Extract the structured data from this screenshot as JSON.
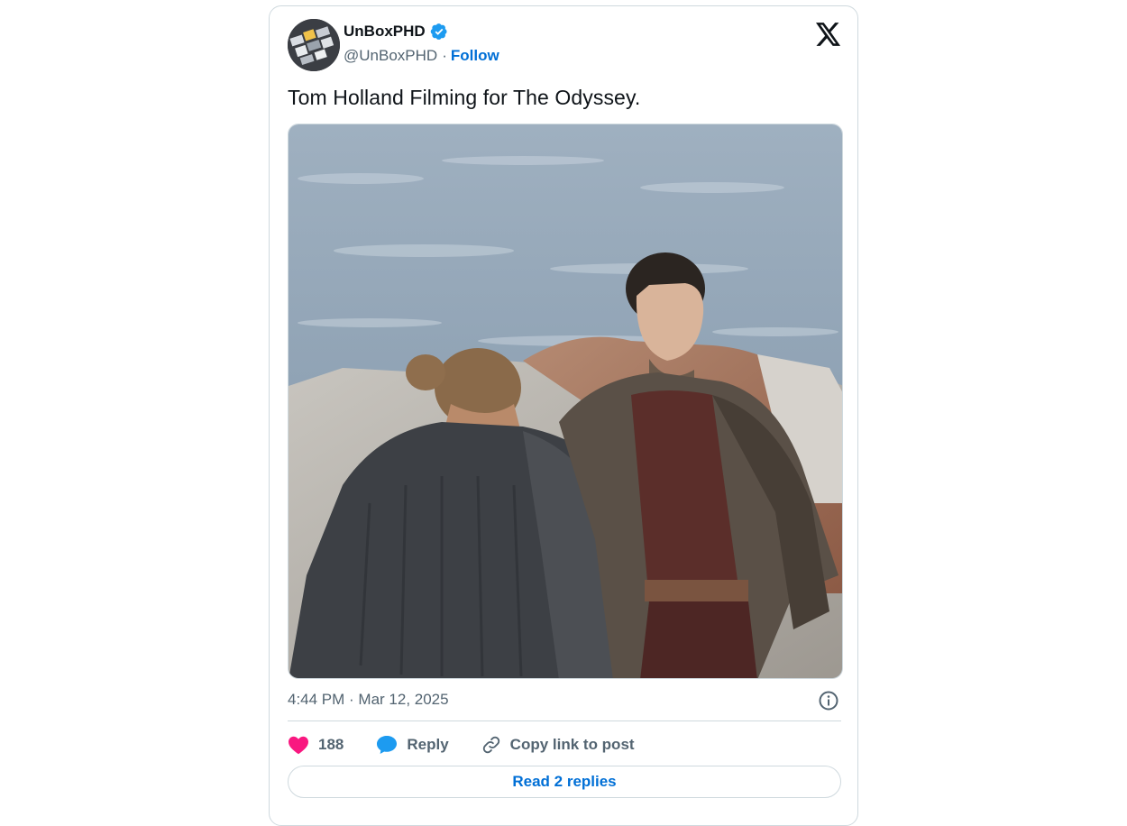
{
  "author": {
    "display_name": "UnBoxPHD",
    "handle": "@UnBoxPHD",
    "separator": "·",
    "follow_label": "Follow",
    "verified": true
  },
  "tweet": {
    "text": "Tom Holland Filming for The Odyssey.",
    "timestamp": "4:44 PM · Mar 12, 2025"
  },
  "actions": {
    "like_count": "188",
    "reply_label": "Reply",
    "copy_link_label": "Copy link to post"
  },
  "replies_button_label": "Read 2 replies",
  "icons": {
    "brand": "x-logo-icon",
    "verified": "verified-badge-icon",
    "info": "info-icon",
    "like": "heart-icon",
    "reply": "speech-bubble-icon",
    "copy": "link-icon"
  },
  "colors": {
    "link_blue": "#006fd6",
    "verified_blue": "#1d9bf0",
    "heart_pink": "#f91880",
    "muted_text": "#536471",
    "border": "#cfd9de"
  }
}
